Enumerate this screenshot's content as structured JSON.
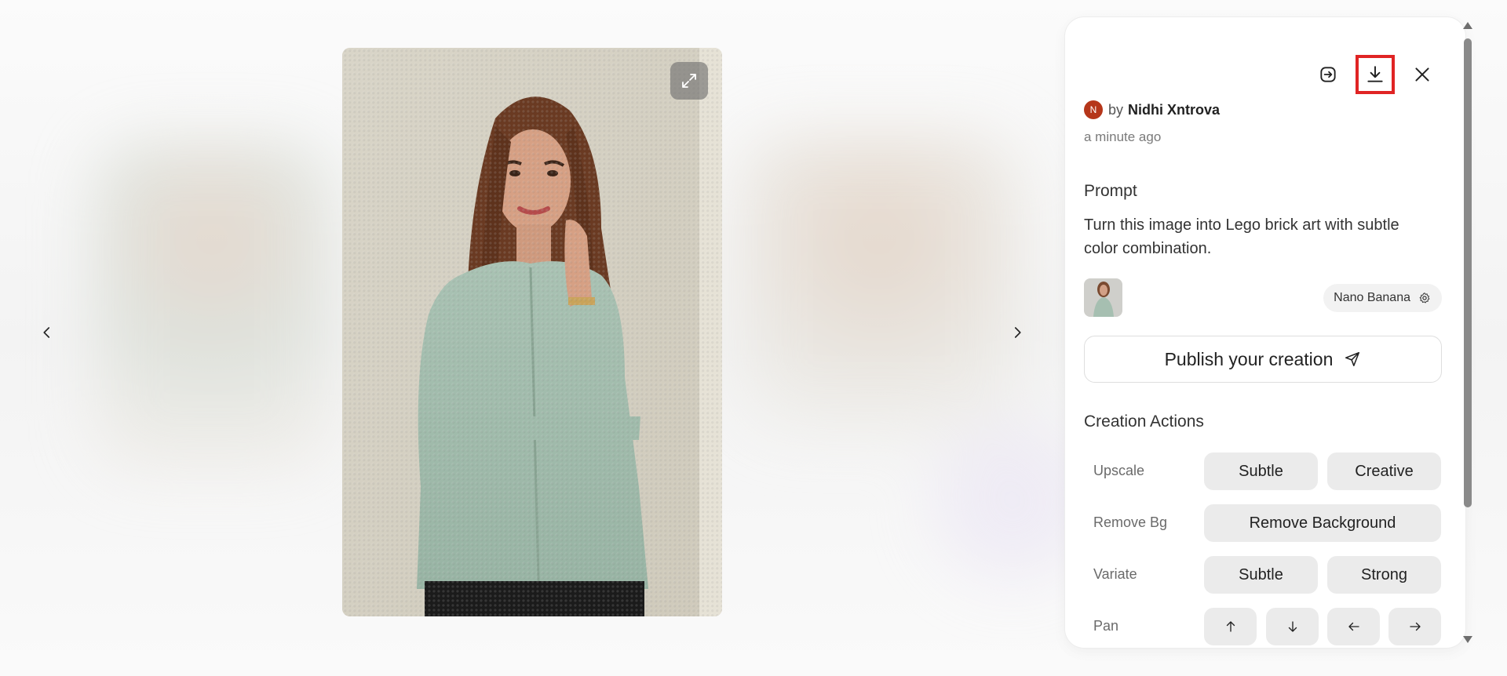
{
  "viewer": {
    "prev_icon": "chevron-left-icon",
    "next_icon": "chevron-right-icon",
    "expand_icon": "expand-arrows-icon"
  },
  "panel": {
    "actions": {
      "share_icon": "share-arrow-icon",
      "download_icon": "download-icon",
      "close_icon": "close-icon"
    },
    "author": {
      "avatar_initial": "N",
      "by_label": "by",
      "name": "Nidhi Xntrova",
      "avatar_color": "#b5361a"
    },
    "timestamp": "a minute ago",
    "prompt": {
      "title": "Prompt",
      "text": "Turn this image into Lego brick art with subtle color combination."
    },
    "model": {
      "label": "Nano Banana",
      "icon": "gear-icon"
    },
    "publish": {
      "label": "Publish your creation",
      "icon": "send-icon"
    },
    "creation_actions": {
      "title": "Creation Actions",
      "upscale": {
        "label": "Upscale",
        "options": [
          "Subtle",
          "Creative"
        ]
      },
      "remove_bg": {
        "label": "Remove Bg",
        "options": [
          "Remove Background"
        ]
      },
      "variate": {
        "label": "Variate",
        "options": [
          "Subtle",
          "Strong"
        ]
      },
      "pan": {
        "label": "Pan",
        "icons": [
          "arrow-up-icon",
          "arrow-down-icon",
          "arrow-left-icon",
          "arrow-right-icon"
        ]
      }
    }
  },
  "colors": {
    "highlight_border": "#e02424",
    "pill_bg": "#ebebeb"
  }
}
